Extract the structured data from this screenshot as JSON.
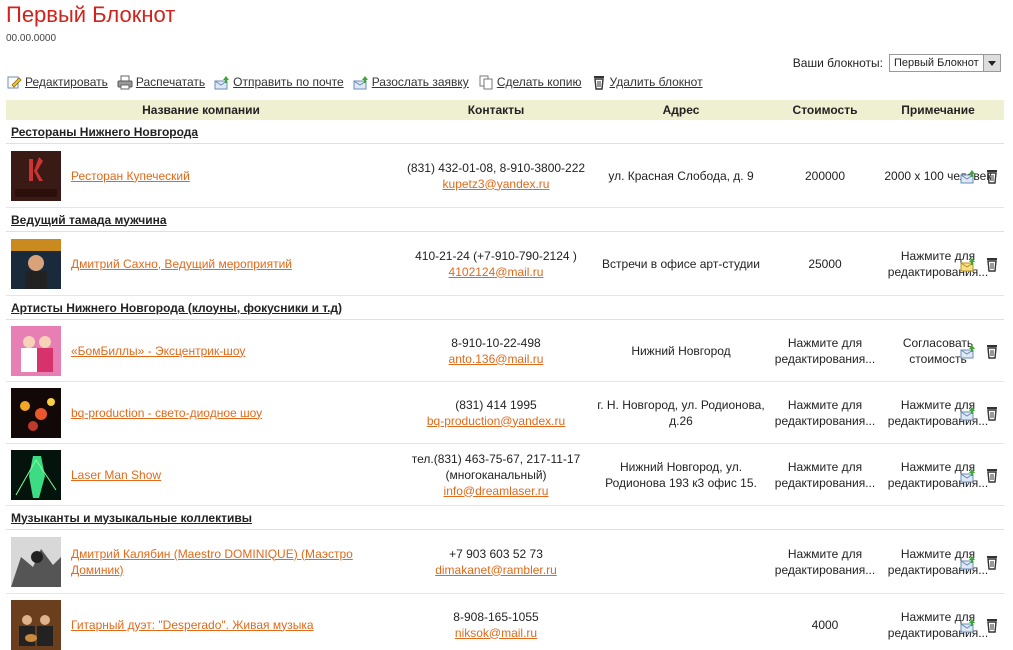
{
  "header": {
    "title": "Первый Блокнот",
    "date": "00.00.0000"
  },
  "notebook_select": {
    "label": "Ваши блокноты:",
    "value": "Первый Блокнот"
  },
  "toolbar": {
    "edit": "Редактировать",
    "print": "Распечатать",
    "send": "Отправить по почте",
    "distribute": "Разослать заявку",
    "copy": "Сделать копию",
    "delete": "Удалить блокнот"
  },
  "table": {
    "headers": {
      "name": "Название компании",
      "contacts": "Контакты",
      "address": "Адрес",
      "cost": "Стоимость",
      "note": "Примечание"
    },
    "groups": [
      {
        "title": "Рестораны Нижнего Новгорода",
        "rows": [
          {
            "company": "Ресторан Купеческий",
            "contacts": "(831) 432-01-08, 8-910-3800-222",
            "email": "kupetz3@yandex.ru",
            "address": "ул. Красная Слобода, д. 9",
            "cost": "200000",
            "note": "2000 х 100 человек"
          }
        ]
      },
      {
        "title": "Ведущий тамада мужчина",
        "rows": [
          {
            "company": "Дмитрий Сахно, Ведущий мероприятий",
            "contacts": "410-21-24 (+7-910-790-2124 )",
            "email": "4102124@mail.ru",
            "address": "Встречи в офисе арт-студии",
            "cost": "25000",
            "note": "Нажмите для редактирования..."
          }
        ]
      },
      {
        "title": "Артисты Нижнего Новгорода (клоуны, фокусники и т.д)",
        "rows": [
          {
            "company": "«БомБиллы» - Эксцентрик-шоу",
            "contacts": "8-910-10-22-498",
            "email": "anto.136@mail.ru",
            "address": "Нижний Новгород",
            "cost": "Нажмите для редактирования...",
            "note": "Согласовать стоимость"
          },
          {
            "company": "bq-production - свето-диодное шоу",
            "contacts": "(831) 414 1995",
            "email": "bq-production@yandex.ru",
            "address": "г. Н. Новгород, ул. Родионова, д.26",
            "cost": "Нажмите для редактирования...",
            "note": "Нажмите для редактирования..."
          },
          {
            "company": "Laser Man Show",
            "contacts": "тел.(831) 463-75-67, 217-11-17 (многоканальный)",
            "email": "info@dreamlaser.ru",
            "address": "Нижний Новгород, ул. Родионова 193 к3 офис 15.",
            "cost": "Нажмите для редактирования...",
            "note": "Нажмите для редактирования..."
          }
        ]
      },
      {
        "title": "Музыканты и музыкальные коллективы",
        "rows": [
          {
            "company": "Дмитрий Калябин (Maestro DOMINIQUE) (Маэстро Доминик)",
            "contacts": "+7 903 603 52 73",
            "email": "dimakanet@rambler.ru",
            "address": "",
            "cost": "Нажмите для редактирования...",
            "note": "Нажмите для редактирования..."
          },
          {
            "company": "Гитарный дуэт: \"Desperado\". Живая музыка",
            "contacts": "8-908-165-1055",
            "email": "niksok@mail.ru",
            "address": "",
            "cost": "4000",
            "note": "Нажмите для редактирования..."
          }
        ]
      }
    ]
  },
  "colors": {
    "title": "#d2221b",
    "link": "#e06a1b",
    "header_bg": "#efefd1"
  }
}
